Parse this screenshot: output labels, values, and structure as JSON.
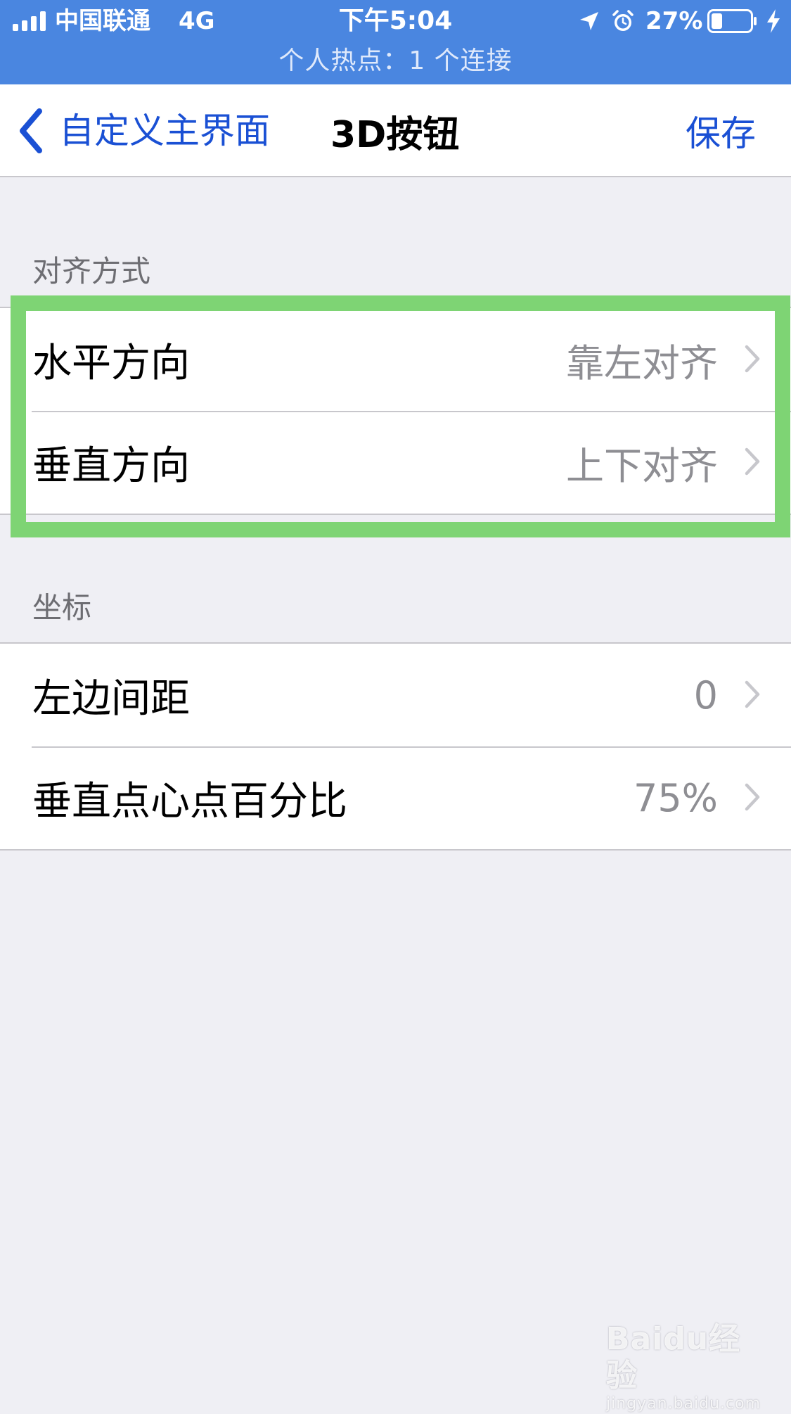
{
  "status_bar": {
    "carrier": "中国联通",
    "network": "4G",
    "time": "下午5:04",
    "battery_percent": "27%",
    "battery_level": 0.27,
    "hotspot": "个人热点：1 个连接",
    "background_color": "#4a86e0"
  },
  "nav": {
    "back_label": "自定义主界面",
    "title": "3D按钮",
    "save_label": "保存",
    "accent_color": "#1a50d4"
  },
  "sections": {
    "alignment": {
      "header": "对齐方式",
      "rows": [
        {
          "label": "水平方向",
          "value": "靠左对齐"
        },
        {
          "label": "垂直方向",
          "value": "上下对齐"
        }
      ]
    },
    "coordinates": {
      "header": "坐标",
      "rows": [
        {
          "label": "左边间距",
          "value": "0"
        },
        {
          "label": "垂直点心点百分比",
          "value": "75%"
        }
      ]
    }
  },
  "highlight_color": "#7ed474",
  "watermark": {
    "logo": "Baidu经验",
    "url": "jingyan.baidu.com"
  }
}
